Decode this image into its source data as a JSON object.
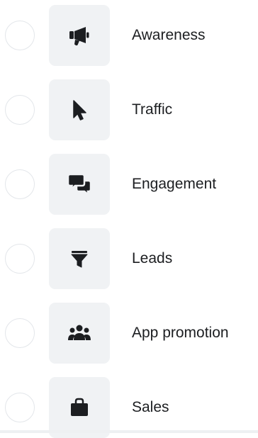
{
  "objectives": [
    {
      "label": "Awareness",
      "icon": "megaphone-icon",
      "selected": false
    },
    {
      "label": "Traffic",
      "icon": "cursor-icon",
      "selected": false
    },
    {
      "label": "Engagement",
      "icon": "chat-bubbles-icon",
      "selected": false
    },
    {
      "label": "Leads",
      "icon": "funnel-icon",
      "selected": false
    },
    {
      "label": "App promotion",
      "icon": "people-group-icon",
      "selected": false
    },
    {
      "label": "Sales",
      "icon": "shopping-bag-icon",
      "selected": false
    }
  ],
  "colors": {
    "icon": "#1c1e21",
    "tile_background": "#f0f2f4",
    "radio_border": "#e3e6ea",
    "text": "#1c1e21"
  }
}
